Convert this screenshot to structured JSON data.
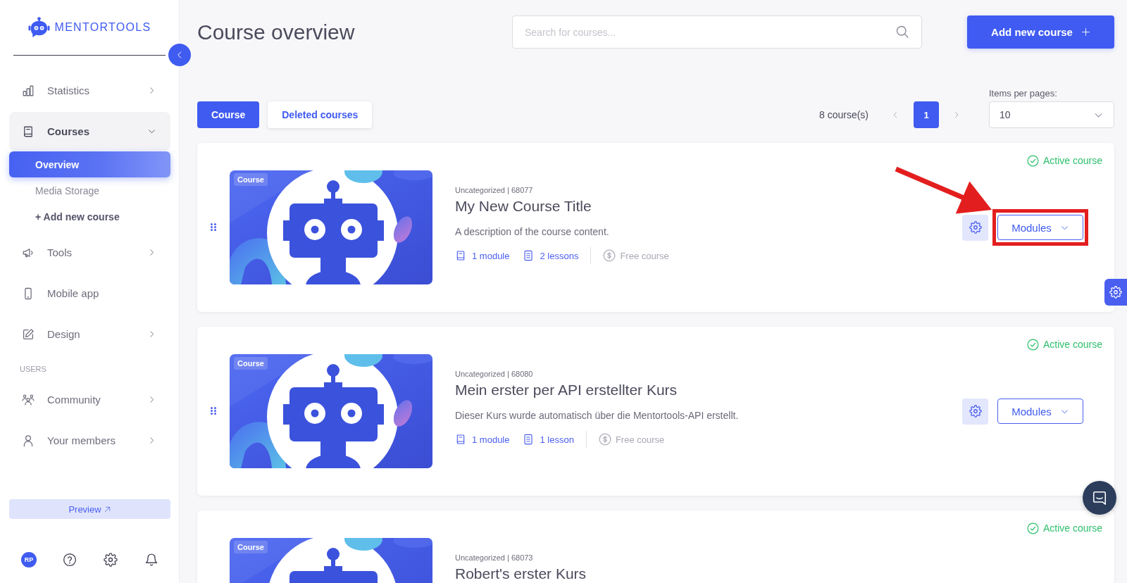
{
  "sidebar": {
    "logo": {
      "text": "MENTORTOOLS"
    },
    "sections": [
      {
        "items": [
          {
            "label": "Statistics",
            "kind": "group",
            "expanded": false,
            "selected": false
          },
          {
            "label": "Courses",
            "kind": "group",
            "expanded": true,
            "selected": false,
            "children": [
              {
                "label": "Overview",
                "kind": "page",
                "selected": true
              },
              {
                "label": "Media Storage",
                "kind": "page",
                "selected": false
              },
              {
                "label": "+ Add new course",
                "kind": "action",
                "selected": false
              }
            ]
          },
          {
            "label": "Tools",
            "kind": "group",
            "expanded": false,
            "selected": false
          },
          {
            "label": "Mobile app",
            "kind": "link",
            "selected": false
          },
          {
            "label": "Design",
            "kind": "group",
            "expanded": false,
            "selected": false
          }
        ]
      },
      {
        "heading": "USERS",
        "items": [
          {
            "label": "Community",
            "kind": "group",
            "expanded": false,
            "selected": false
          },
          {
            "label": "Your members",
            "kind": "group",
            "expanded": false,
            "selected": false
          }
        ]
      }
    ],
    "preview_button": {
      "label": "Preview"
    },
    "footer": {
      "avatar_initials": "RP"
    }
  },
  "header": {
    "title": "Course overview",
    "search": {
      "placeholder": "Search for courses..."
    },
    "add_button": {
      "label": "Add new course"
    }
  },
  "toolbar": {
    "tabs": [
      {
        "label": "Course",
        "selected": true
      },
      {
        "label": "Deleted courses",
        "selected": false
      }
    ],
    "count": "8 course(s)",
    "pages": [
      {
        "label": "1",
        "selected": true
      }
    ],
    "per_page": {
      "label": "Items per pages:",
      "value": "10"
    }
  },
  "courses": [
    {
      "badge": "Course",
      "category": "Uncategorized | 68077",
      "title": "My New Course Title",
      "description": "A description of the course content.",
      "modules": "1 module",
      "lessons": "2 lessons",
      "price": "Free course",
      "status": "Active course",
      "active": true,
      "action": "Modules",
      "annotated": true
    },
    {
      "badge": "Course",
      "category": "Uncategorized | 68080",
      "title": "Mein erster per API erstellter Kurs",
      "description": "Dieser Kurs wurde automatisch über die Mentortools-API erstellt.",
      "modules": "1 module",
      "lessons": "1 lesson",
      "price": "Free course",
      "status": "Active course",
      "active": true,
      "action": "Modules",
      "annotated": false
    },
    {
      "badge": "Course",
      "category": "Uncategorized | 68073",
      "title": "Robert's erster Kurs",
      "status": "Active course",
      "active": true,
      "annotated": false
    }
  ]
}
